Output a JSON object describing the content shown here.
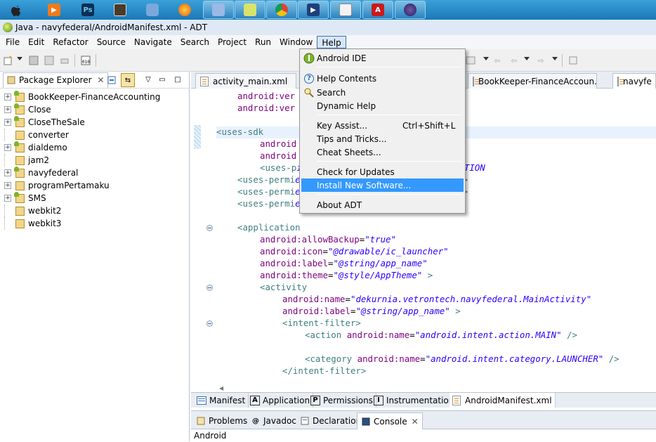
{
  "window": {
    "title": "Java - navyfederal/AndroidManifest.xml - ADT"
  },
  "taskbar": {
    "apps": [
      {
        "icon": "apple-icon"
      },
      {
        "icon": "media-player-icon"
      },
      {
        "icon": "photoshop-icon",
        "text": "Ps"
      },
      {
        "icon": "notes-icon"
      },
      {
        "icon": "virtualbox-icon"
      },
      {
        "icon": "firefox-icon"
      },
      {
        "icon": "explorer-icon"
      },
      {
        "icon": "network-icon"
      },
      {
        "icon": "chrome-icon"
      },
      {
        "icon": "media-icon"
      },
      {
        "icon": "notepad-icon"
      },
      {
        "icon": "acrobat-icon"
      },
      {
        "icon": "eclipse-icon"
      }
    ]
  },
  "menubar": {
    "items": [
      "File",
      "Edit",
      "Refactor",
      "Source",
      "Navigate",
      "Search",
      "Project",
      "Run",
      "Window",
      "Help"
    ],
    "active": "Help"
  },
  "help_menu": {
    "items": [
      {
        "label": "Android IDE",
        "icon": "android-ide-icon"
      },
      {
        "label": "Help Contents",
        "icon": "help-icon"
      },
      {
        "label": "Search",
        "icon": "search-help-icon"
      },
      {
        "label": "Dynamic Help"
      },
      {
        "label": "Key Assist...",
        "accel": "Ctrl+Shift+L"
      },
      {
        "label": "Tips and Tricks..."
      },
      {
        "label": "Cheat Sheets..."
      },
      {
        "label": "Check for Updates"
      },
      {
        "label": "Install New Software...",
        "selected": true
      },
      {
        "label": "About ADT"
      }
    ]
  },
  "package_explorer": {
    "title": "Package Explorer",
    "projects": [
      {
        "name": "BookKeeper-FinanceAccounting",
        "expandable": true,
        "android": true
      },
      {
        "name": "Close",
        "expandable": true,
        "android": true
      },
      {
        "name": "CloseTheSale",
        "expandable": true,
        "android": true
      },
      {
        "name": "converter",
        "expandable": false,
        "android": false
      },
      {
        "name": "dialdemo",
        "expandable": true,
        "android": true
      },
      {
        "name": "jam2",
        "expandable": false,
        "android": false
      },
      {
        "name": "navyfederal",
        "expandable": true,
        "android": true
      },
      {
        "name": "programPertamaku",
        "expandable": true,
        "android": false
      },
      {
        "name": "SMS",
        "expandable": true,
        "android": true
      },
      {
        "name": "webkit2",
        "expandable": false,
        "android": false
      },
      {
        "name": "webkit3",
        "expandable": false,
        "android": false
      }
    ]
  },
  "editor": {
    "tabs": [
      "activity_main.xml",
      "BookKeeper-FinanceAccoun...",
      "navyfe"
    ],
    "code_lines": [
      [
        {
          "c": "attr",
          "t": "android:ver"
        }
      ],
      [
        {
          "c": "attr",
          "t": "android:ver"
        }
      ],
      [],
      [
        {
          "c": "tag",
          "t": "<uses-sdk"
        }
      ],
      [
        {
          "c": "attr",
          "t": "android"
        }
      ],
      [
        {
          "c": "attr",
          "t": "android"
        }
      ],
      [
        {
          "c": "tag",
          "t": "<uses-p"
        },
        {
          "c": "val",
          "t": "id.permission.ACCESS_COARSE_LOCATION"
        }
      ],
      [
        {
          "c": "tag",
          "t": "<uses-permi"
        },
        {
          "c": "val",
          "t": "ermission.ACCESS_FINE_LOCATION\""
        },
        {
          "c": "tag",
          "t": "/>"
        }
      ],
      [
        {
          "c": "tag",
          "t": "<uses-permi"
        },
        {
          "c": "val",
          "t": "ermission.ACCESS_NETWORK_STATE\""
        },
        {
          "c": "tag",
          "t": "/>"
        }
      ],
      [
        {
          "c": "tag",
          "t": "<uses-permi"
        },
        {
          "c": "val",
          "t": "ermission.INTERNET\""
        },
        {
          "c": "tag",
          "t": "/>"
        }
      ],
      [],
      [
        {
          "c": "tag",
          "t": "<application"
        }
      ],
      [
        {
          "c": "attr",
          "t": "android:allowBackup"
        },
        {
          "c": "plain",
          "t": "="
        },
        {
          "c": "val",
          "t": "\"true\""
        }
      ],
      [
        {
          "c": "attr",
          "t": "android:icon"
        },
        {
          "c": "plain",
          "t": "="
        },
        {
          "c": "val",
          "t": "\"@drawable/ic_launcher\""
        }
      ],
      [
        {
          "c": "attr",
          "t": "android:label"
        },
        {
          "c": "plain",
          "t": "="
        },
        {
          "c": "val",
          "t": "\"@string/app_name\""
        }
      ],
      [
        {
          "c": "attr",
          "t": "android:theme"
        },
        {
          "c": "plain",
          "t": "="
        },
        {
          "c": "val",
          "t": "\"@style/AppTheme\""
        },
        {
          "c": "tag",
          "t": " >"
        }
      ],
      [
        {
          "c": "tag",
          "t": "<activity"
        }
      ],
      [
        {
          "c": "attr",
          "t": "android:name"
        },
        {
          "c": "plain",
          "t": "="
        },
        {
          "c": "val",
          "t": "\"dekurnia.vetrontech.navyfederal.MainActivity\""
        }
      ],
      [
        {
          "c": "attr",
          "t": "android:label"
        },
        {
          "c": "plain",
          "t": "="
        },
        {
          "c": "val",
          "t": "\"@string/app_name\""
        },
        {
          "c": "tag",
          "t": " >"
        }
      ],
      [
        {
          "c": "tag",
          "t": "<intent-filter>"
        }
      ],
      [
        {
          "c": "tag",
          "t": "<action "
        },
        {
          "c": "attr",
          "t": "android:name"
        },
        {
          "c": "plain",
          "t": "="
        },
        {
          "c": "val",
          "t": "\"android.intent.action.MAIN\""
        },
        {
          "c": "tag",
          "t": " />"
        }
      ],
      [],
      [
        {
          "c": "tag",
          "t": "<category "
        },
        {
          "c": "attr",
          "t": "android:name"
        },
        {
          "c": "plain",
          "t": "="
        },
        {
          "c": "val",
          "t": "\"android.intent.category.LAUNCHER\""
        },
        {
          "c": "tag",
          "t": " />"
        }
      ],
      [
        {
          "c": "tag",
          "t": "</intent-filter>"
        }
      ]
    ],
    "bottom_tabs": [
      {
        "label": "Manifest",
        "icon": "manifest-icon"
      },
      {
        "label": "Application",
        "letter": "A"
      },
      {
        "label": "Permissions",
        "letter": "P"
      },
      {
        "label": "Instrumentation",
        "letter": "I"
      },
      {
        "label": "AndroidManifest.xml",
        "icon": "xml-file-icon",
        "current": true
      }
    ]
  },
  "console_view": {
    "tabs": [
      {
        "label": "Problems",
        "icon": "problems-icon"
      },
      {
        "label": "Javadoc",
        "icon": "javadoc-icon"
      },
      {
        "label": "Declaration",
        "icon": "declaration-icon"
      },
      {
        "label": "Console",
        "icon": "console-icon",
        "current": true
      }
    ],
    "output": "Android"
  }
}
